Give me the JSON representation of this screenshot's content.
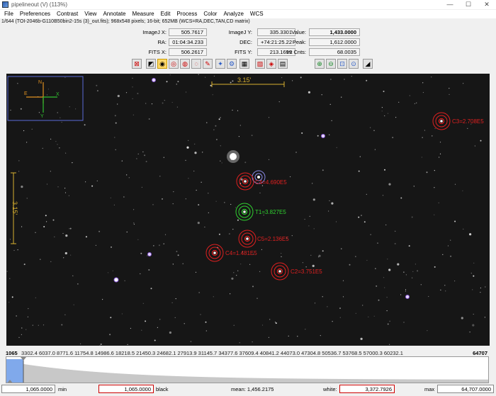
{
  "window": {
    "title": "pipelineout (V) (113%)",
    "minimize_glyph": "—",
    "maximize_glyph": "☐",
    "close_glyph": "✕"
  },
  "menu": [
    "File",
    "Preferences",
    "Contrast",
    "View",
    "Annotate",
    "Measure",
    "Edit",
    "Process",
    "Color",
    "Analyze",
    "WCS"
  ],
  "info_line": "1/644 (TOI-2046b-G110B50bin2-15s (3)_out.fits); 968x548 pixels; 16-bit; 652MB (WCS=RA,DEC,TAN,CD matrix)",
  "stats": {
    "imagej_x_label": "ImageJ X:",
    "imagej_x": "505.7617",
    "imagej_y_label": "ImageJ Y:",
    "imagej_y": "335.3301",
    "value_label": "Value:",
    "value": "1,433.0000",
    "ra_label": "RA:",
    "ra": "01:04:34.233",
    "dec_label": "DEC:",
    "dec": "+74:21:25.22",
    "peak_label": "Peak:",
    "peak": "1,612.0000",
    "fits_x_label": "FITS X:",
    "fits_x": "506.2617",
    "fits_y_label": "FITS Y:",
    "fits_y": "213.1699",
    "int_cnts_label": "Int Cnts:",
    "int_cnts": "68.0035"
  },
  "toolbar": {
    "icons": [
      "clear-overlay-icon",
      "negative-display-icon",
      "aperture-icon",
      "multi-aperture-icon",
      "radial-profile-icon",
      "seeing-profile-icon",
      "measure-icon",
      "astrometry-icon",
      "settings-icon",
      "header-icon",
      "delete-icon",
      "stack-icon",
      "align-icon",
      "zoom-in-icon",
      "zoom-out-icon",
      "zoom-fit-icon",
      "zoom-100-icon",
      "contrast-icon"
    ],
    "glyphs": [
      "⊠",
      "◩",
      "◉",
      "◎",
      "◍",
      "◌",
      "✎",
      "✦",
      "⚙",
      "▦",
      "▨",
      "◈",
      "▤",
      "⊕",
      "⊖",
      "⊡",
      "⊙",
      "◢"
    ]
  },
  "image": {
    "scale_label_top": "3.15'",
    "scale_label_left": "3.15'",
    "compass": {
      "n": "N",
      "e": "E",
      "x": "X",
      "y": "Y"
    },
    "apertures": [
      {
        "label": "C3=2.708E5",
        "color": "#e02020"
      },
      {
        "label": "C4=4.690E5",
        "color": "#e02020"
      },
      {
        "label": "T1=3.827E5",
        "color": "#30d030"
      },
      {
        "label": "C5=2.136E5",
        "color": "#e02020"
      },
      {
        "label": "C4=1.481E5",
        "color": "#e02020"
      },
      {
        "label": "C2=3.751E5",
        "color": "#e02020"
      }
    ]
  },
  "histogram": {
    "min_tick": "1065",
    "ticks": "3302.4  6037.0  8771.6  11754.8  14986.6  18218.5  21450.3  24682.1  27913.9  31145.7  34377.6  37609.4  40841.2  44073.0  47304.8  50536.7  53768.5  57000.3  60232.1",
    "max_tick": "64707"
  },
  "bottom": {
    "min_box": "1,065.0000",
    "min_label": "min",
    "black_box": "1,065.0000",
    "black_label": "black",
    "mean_label": "mean: 1,456.2175",
    "white_label": "white:",
    "white_box": "3,372.7926",
    "max_label": "max",
    "max_box": "64,707.0000"
  }
}
